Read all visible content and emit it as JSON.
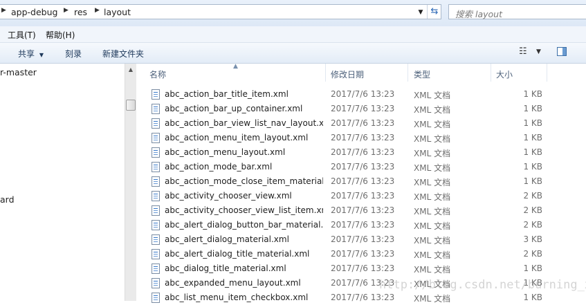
{
  "address_bar": {
    "crumbs": [
      "app-debug",
      "res",
      "layout"
    ],
    "search_placeholder": "搜索 layout"
  },
  "menu": [
    "工具(T)",
    "帮助(H)"
  ],
  "toolbar": {
    "share": "共享",
    "burn": "刻录",
    "new_folder": "新建文件夹"
  },
  "nav_pane": {
    "items": [
      "r-master",
      "ard"
    ]
  },
  "columns": {
    "name": "名称",
    "date": "修改日期",
    "type": "类型",
    "size": "大小"
  },
  "files": [
    {
      "name": "abc_action_bar_title_item.xml",
      "date": "2017/7/6 13:23",
      "type": "XML 文档",
      "size": "1 KB"
    },
    {
      "name": "abc_action_bar_up_container.xml",
      "date": "2017/7/6 13:23",
      "type": "XML 文档",
      "size": "1 KB"
    },
    {
      "name": "abc_action_bar_view_list_nav_layout.xml",
      "date": "2017/7/6 13:23",
      "type": "XML 文档",
      "size": "1 KB"
    },
    {
      "name": "abc_action_menu_item_layout.xml",
      "date": "2017/7/6 13:23",
      "type": "XML 文档",
      "size": "1 KB"
    },
    {
      "name": "abc_action_menu_layout.xml",
      "date": "2017/7/6 13:23",
      "type": "XML 文档",
      "size": "1 KB"
    },
    {
      "name": "abc_action_mode_bar.xml",
      "date": "2017/7/6 13:23",
      "type": "XML 文档",
      "size": "1 KB"
    },
    {
      "name": "abc_action_mode_close_item_material...",
      "date": "2017/7/6 13:23",
      "type": "XML 文档",
      "size": "1 KB"
    },
    {
      "name": "abc_activity_chooser_view.xml",
      "date": "2017/7/6 13:23",
      "type": "XML 文档",
      "size": "2 KB"
    },
    {
      "name": "abc_activity_chooser_view_list_item.xml",
      "date": "2017/7/6 13:23",
      "type": "XML 文档",
      "size": "2 KB"
    },
    {
      "name": "abc_alert_dialog_button_bar_material....",
      "date": "2017/7/6 13:23",
      "type": "XML 文档",
      "size": "2 KB"
    },
    {
      "name": "abc_alert_dialog_material.xml",
      "date": "2017/7/6 13:23",
      "type": "XML 文档",
      "size": "3 KB"
    },
    {
      "name": "abc_alert_dialog_title_material.xml",
      "date": "2017/7/6 13:23",
      "type": "XML 文档",
      "size": "2 KB"
    },
    {
      "name": "abc_dialog_title_material.xml",
      "date": "2017/7/6 13:23",
      "type": "XML 文档",
      "size": "1 KB"
    },
    {
      "name": "abc_expanded_menu_layout.xml",
      "date": "2017/7/6 13:23",
      "type": "XML 文档",
      "size": "1 KB"
    },
    {
      "name": "abc_list_menu_item_checkbox.xml",
      "date": "2017/7/6 13:23",
      "type": "XML 文档",
      "size": "1 KB"
    }
  ],
  "watermark": "http://blog.csdn.net/burning_xl",
  "colors": {
    "toolbar_bg": "#e3ecf7",
    "header_text": "#4c607a",
    "link_blue": "#2a67b5"
  }
}
